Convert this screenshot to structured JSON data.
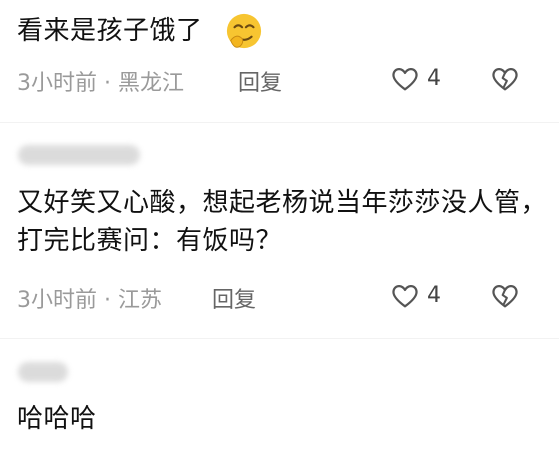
{
  "comments": [
    {
      "text": "看来是孩子饿了",
      "emoji": "smirk-face-emoji",
      "time": "3小时前",
      "separator": "·",
      "location": "黑龙江",
      "reply_label": "回复",
      "likes": "4"
    },
    {
      "username": "",
      "text": "又好笑又心酸，想起老杨说当年莎莎没人管，打完比赛问：有饭吗？",
      "time": "3小时前",
      "separator": "·",
      "location": "江苏",
      "reply_label": "回复",
      "likes": "4"
    },
    {
      "username": "",
      "text": "哈哈哈"
    }
  ],
  "colors": {
    "text": "#111111",
    "meta": "#9a9a9a",
    "icon": "#555555",
    "emoji": "#f7c531"
  }
}
